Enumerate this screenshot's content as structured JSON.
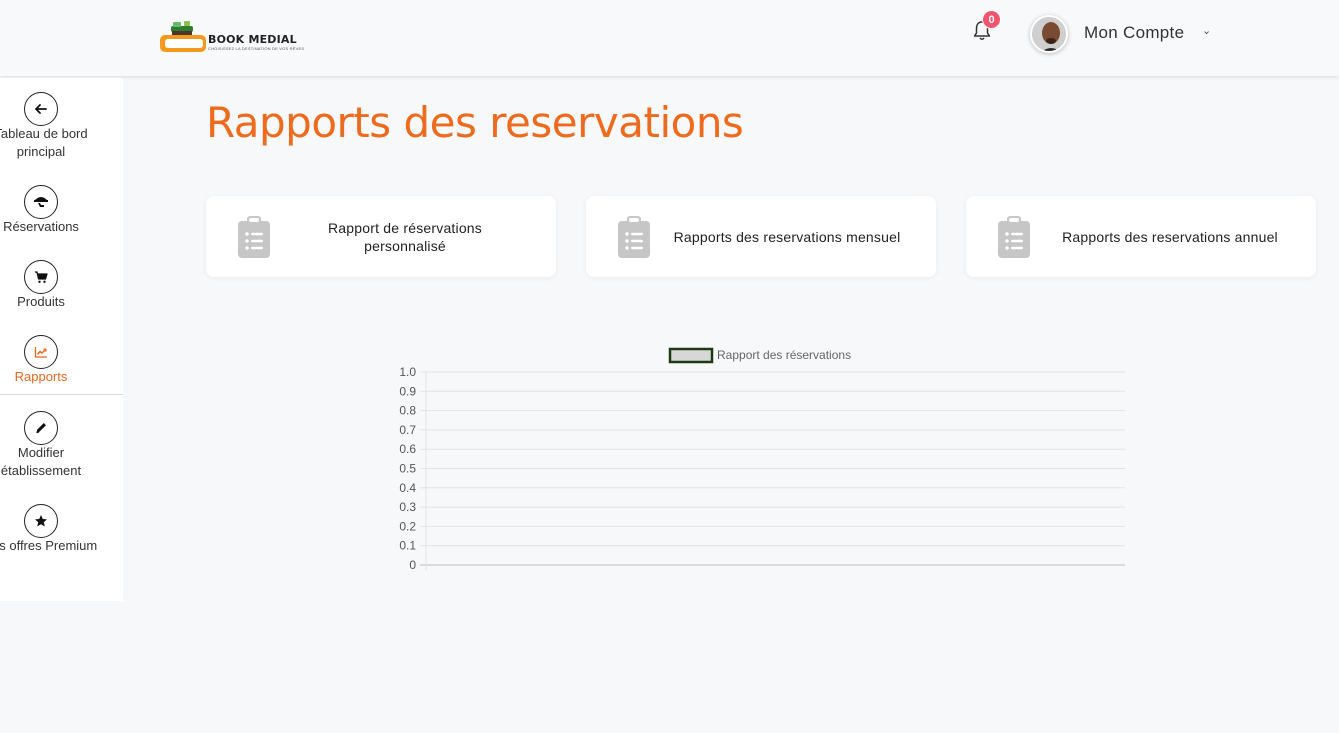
{
  "header": {
    "logo_text": "BOOK MEDIAL",
    "logo_tagline": "CHOISISSEZ LA DESTINATION DE VOS RÊVES",
    "notification_count": "0",
    "account_label": "Mon Compte",
    "account_chevron": "⌄"
  },
  "sidebar": {
    "items": [
      {
        "label": "Tableau de bord\nprincipal",
        "icon": "arrow-left-icon"
      },
      {
        "label": "Réservations",
        "icon": "waiter-tray-icon"
      },
      {
        "label": "Produits",
        "icon": "cart-icon"
      },
      {
        "label": "Rapports",
        "icon": "chart-line-icon",
        "active": true
      },
      {
        "label": "Modifier\nétablissement",
        "icon": "pencil-icon"
      },
      {
        "label": "Les offres Premium",
        "icon": "star-icon"
      }
    ]
  },
  "page": {
    "title": "Rapports des reservations"
  },
  "cards": [
    {
      "label": "Rapport de réservations personnalisé",
      "icon": "clipboard-list-icon"
    },
    {
      "label": "Rapports des reservations mensuel",
      "icon": "clipboard-list-icon"
    },
    {
      "label": "Rapports des reservations annuel",
      "icon": "clipboard-list-icon"
    }
  ],
  "colors": {
    "accent": "#ee6a1d",
    "badge": "#f2536e",
    "legend_box_fill": "#d7d7d7",
    "legend_box_border": "#1e3a12"
  },
  "chart_data": {
    "type": "line",
    "series": [
      {
        "name": "Rapport des réservations",
        "values": []
      }
    ],
    "ylim": [
      0,
      1
    ],
    "yticks": [
      "0",
      "0.1",
      "0.2",
      "0.3",
      "0.4",
      "0.5",
      "0.6",
      "0.7",
      "0.8",
      "0.9",
      "1.0"
    ],
    "grid": true,
    "legend": "top"
  }
}
